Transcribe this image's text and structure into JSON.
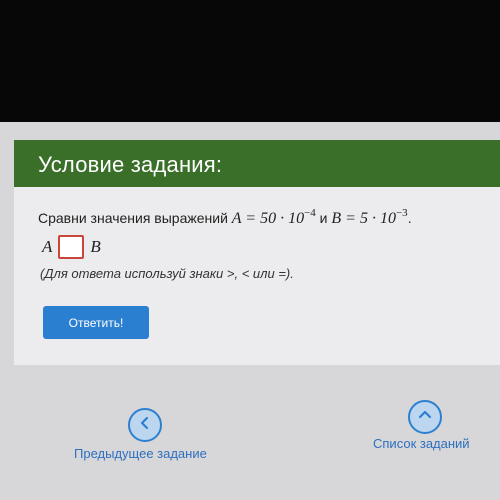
{
  "card": {
    "title": "Условие задания:",
    "task_text": "Сравни значения выражений",
    "expr_a": "A = 50 · 10",
    "expr_a_exp": "−4",
    "conj": "и",
    "expr_b": "B = 5 · 10",
    "expr_b_exp": "−3",
    "end_dot": ".",
    "answer_left": "A",
    "answer_right": "B",
    "hint": "(Для ответа используй знаки >, < или =).",
    "submit_label": "Ответить!"
  },
  "nav": {
    "prev_label": "Предыдущее задание",
    "list_label": "Список заданий"
  },
  "colors": {
    "header_green": "#3a6f2a",
    "submit_blue": "#2a7fd0",
    "answer_box_border": "#c9463d",
    "link_blue": "#2d6fc0"
  },
  "icons": {
    "prev": "chevron-left-icon",
    "list": "chevron-up-icon"
  }
}
